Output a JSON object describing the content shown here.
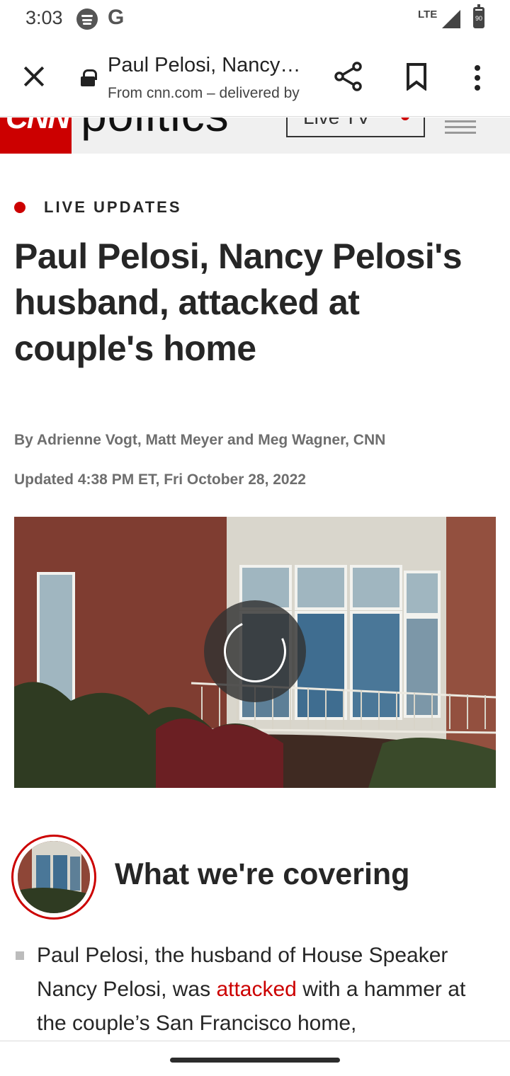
{
  "status_bar": {
    "time": "3:03",
    "network": "LTE",
    "battery": "90",
    "icons": [
      "spotify-icon",
      "google-icon",
      "signal-icon",
      "battery-icon"
    ]
  },
  "toolbar": {
    "title": "Paul Pelosi, Nancy Pelosi's husband, attacked at couple's home",
    "url": "From cnn.com – delivered by Google",
    "icons": [
      "close-icon",
      "lock-icon",
      "share-icon",
      "bookmark-icon",
      "more-vert-icon"
    ]
  },
  "site_header": {
    "logo": "CNN",
    "section": "politics",
    "live_tv": "Live TV",
    "accent_color": "#cc0000"
  },
  "article": {
    "tag": "LIVE UPDATES",
    "headline": "Paul Pelosi, Nancy Pelosi's husband, attacked at couple's home",
    "byline": "By Adrienne Vogt, Matt Meyer and Meg Wagner, CNN",
    "updated": "Updated 4:38 PM ET, Fri October 28, 2022"
  },
  "covering": {
    "heading": "What we're covering",
    "bullet_prefix": "Paul Pelosi, the husband of House Speaker Nancy Pelosi, was ",
    "bullet_link": "attacked",
    "bullet_suffix": " with a hammer at the couple’s San Francisco home,"
  }
}
